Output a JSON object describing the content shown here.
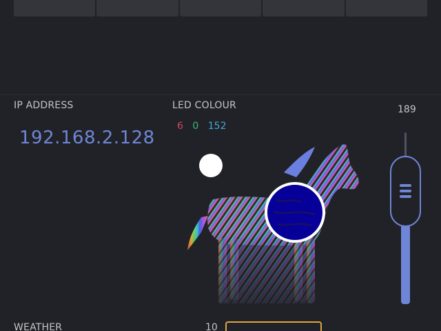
{
  "tabs": [
    "",
    "",
    "",
    "",
    ""
  ],
  "ip_widget": {
    "label": "IP ADDRESS",
    "value": "192.168.2.128"
  },
  "led_widget": {
    "label": "LED COLOUR",
    "rgb": {
      "r": "6",
      "g": "0",
      "b": "152"
    },
    "selected_color": "#060098"
  },
  "slider": {
    "value": "189",
    "accent": "#6f86d6"
  },
  "weather": {
    "label": "WEATHER",
    "value": "10"
  },
  "colors": {
    "background": "#212227",
    "accent": "#6f86d6",
    "weather_border": "#e0a63d"
  }
}
